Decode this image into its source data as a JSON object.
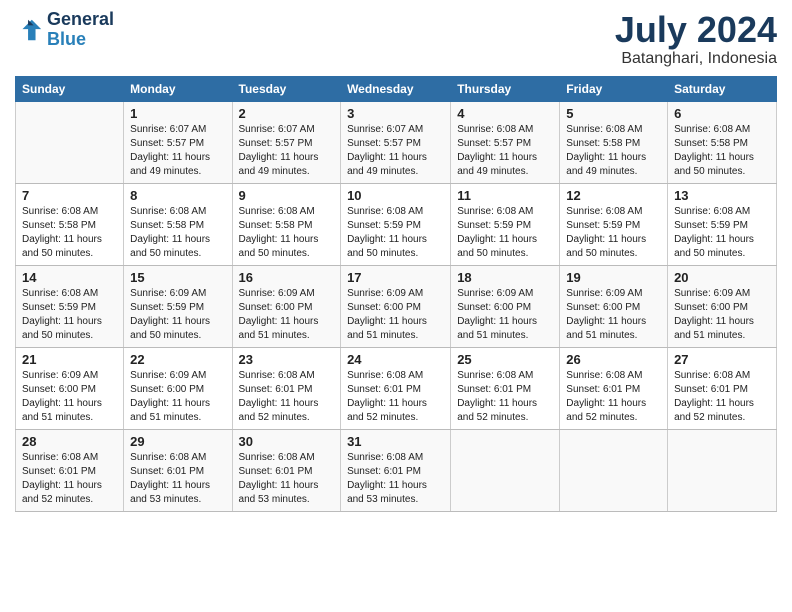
{
  "header": {
    "logo_line1": "General",
    "logo_line2": "Blue",
    "main_title": "July 2024",
    "subtitle": "Batanghari, Indonesia"
  },
  "columns": [
    "Sunday",
    "Monday",
    "Tuesday",
    "Wednesday",
    "Thursday",
    "Friday",
    "Saturday"
  ],
  "weeks": [
    [
      {
        "num": "",
        "info": ""
      },
      {
        "num": "1",
        "info": "Sunrise: 6:07 AM\nSunset: 5:57 PM\nDaylight: 11 hours\nand 49 minutes."
      },
      {
        "num": "2",
        "info": "Sunrise: 6:07 AM\nSunset: 5:57 PM\nDaylight: 11 hours\nand 49 minutes."
      },
      {
        "num": "3",
        "info": "Sunrise: 6:07 AM\nSunset: 5:57 PM\nDaylight: 11 hours\nand 49 minutes."
      },
      {
        "num": "4",
        "info": "Sunrise: 6:08 AM\nSunset: 5:57 PM\nDaylight: 11 hours\nand 49 minutes."
      },
      {
        "num": "5",
        "info": "Sunrise: 6:08 AM\nSunset: 5:58 PM\nDaylight: 11 hours\nand 49 minutes."
      },
      {
        "num": "6",
        "info": "Sunrise: 6:08 AM\nSunset: 5:58 PM\nDaylight: 11 hours\nand 50 minutes."
      }
    ],
    [
      {
        "num": "7",
        "info": "Sunrise: 6:08 AM\nSunset: 5:58 PM\nDaylight: 11 hours\nand 50 minutes."
      },
      {
        "num": "8",
        "info": "Sunrise: 6:08 AM\nSunset: 5:58 PM\nDaylight: 11 hours\nand 50 minutes."
      },
      {
        "num": "9",
        "info": "Sunrise: 6:08 AM\nSunset: 5:58 PM\nDaylight: 11 hours\nand 50 minutes."
      },
      {
        "num": "10",
        "info": "Sunrise: 6:08 AM\nSunset: 5:59 PM\nDaylight: 11 hours\nand 50 minutes."
      },
      {
        "num": "11",
        "info": "Sunrise: 6:08 AM\nSunset: 5:59 PM\nDaylight: 11 hours\nand 50 minutes."
      },
      {
        "num": "12",
        "info": "Sunrise: 6:08 AM\nSunset: 5:59 PM\nDaylight: 11 hours\nand 50 minutes."
      },
      {
        "num": "13",
        "info": "Sunrise: 6:08 AM\nSunset: 5:59 PM\nDaylight: 11 hours\nand 50 minutes."
      }
    ],
    [
      {
        "num": "14",
        "info": "Sunrise: 6:08 AM\nSunset: 5:59 PM\nDaylight: 11 hours\nand 50 minutes."
      },
      {
        "num": "15",
        "info": "Sunrise: 6:09 AM\nSunset: 5:59 PM\nDaylight: 11 hours\nand 50 minutes."
      },
      {
        "num": "16",
        "info": "Sunrise: 6:09 AM\nSunset: 6:00 PM\nDaylight: 11 hours\nand 51 minutes."
      },
      {
        "num": "17",
        "info": "Sunrise: 6:09 AM\nSunset: 6:00 PM\nDaylight: 11 hours\nand 51 minutes."
      },
      {
        "num": "18",
        "info": "Sunrise: 6:09 AM\nSunset: 6:00 PM\nDaylight: 11 hours\nand 51 minutes."
      },
      {
        "num": "19",
        "info": "Sunrise: 6:09 AM\nSunset: 6:00 PM\nDaylight: 11 hours\nand 51 minutes."
      },
      {
        "num": "20",
        "info": "Sunrise: 6:09 AM\nSunset: 6:00 PM\nDaylight: 11 hours\nand 51 minutes."
      }
    ],
    [
      {
        "num": "21",
        "info": "Sunrise: 6:09 AM\nSunset: 6:00 PM\nDaylight: 11 hours\nand 51 minutes."
      },
      {
        "num": "22",
        "info": "Sunrise: 6:09 AM\nSunset: 6:00 PM\nDaylight: 11 hours\nand 51 minutes."
      },
      {
        "num": "23",
        "info": "Sunrise: 6:08 AM\nSunset: 6:01 PM\nDaylight: 11 hours\nand 52 minutes."
      },
      {
        "num": "24",
        "info": "Sunrise: 6:08 AM\nSunset: 6:01 PM\nDaylight: 11 hours\nand 52 minutes."
      },
      {
        "num": "25",
        "info": "Sunrise: 6:08 AM\nSunset: 6:01 PM\nDaylight: 11 hours\nand 52 minutes."
      },
      {
        "num": "26",
        "info": "Sunrise: 6:08 AM\nSunset: 6:01 PM\nDaylight: 11 hours\nand 52 minutes."
      },
      {
        "num": "27",
        "info": "Sunrise: 6:08 AM\nSunset: 6:01 PM\nDaylight: 11 hours\nand 52 minutes."
      }
    ],
    [
      {
        "num": "28",
        "info": "Sunrise: 6:08 AM\nSunset: 6:01 PM\nDaylight: 11 hours\nand 52 minutes."
      },
      {
        "num": "29",
        "info": "Sunrise: 6:08 AM\nSunset: 6:01 PM\nDaylight: 11 hours\nand 53 minutes."
      },
      {
        "num": "30",
        "info": "Sunrise: 6:08 AM\nSunset: 6:01 PM\nDaylight: 11 hours\nand 53 minutes."
      },
      {
        "num": "31",
        "info": "Sunrise: 6:08 AM\nSunset: 6:01 PM\nDaylight: 11 hours\nand 53 minutes."
      },
      {
        "num": "",
        "info": ""
      },
      {
        "num": "",
        "info": ""
      },
      {
        "num": "",
        "info": ""
      }
    ]
  ]
}
